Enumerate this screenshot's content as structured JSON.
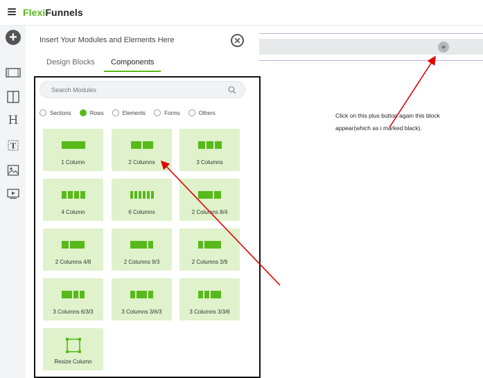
{
  "app": {
    "logo_part1": "Flexi",
    "logo_part2": "Funnels",
    "brand_color": "#58b91a"
  },
  "rail": {
    "icons": [
      "plus-icon",
      "section-icon",
      "columns-icon",
      "heading-icon",
      "text-icon",
      "image-icon",
      "video-icon"
    ]
  },
  "panel": {
    "title": "Insert Your Modules and Elements Here",
    "tabs": [
      {
        "label": "Design Blocks",
        "active": false
      },
      {
        "label": "Components",
        "active": true
      }
    ],
    "search_placeholder": "Search Modules",
    "filters": [
      {
        "label": "Sections",
        "checked": false
      },
      {
        "label": "Rows",
        "checked": true
      },
      {
        "label": "Elements",
        "checked": false
      },
      {
        "label": "Forms",
        "checked": false
      },
      {
        "label": "Others",
        "checked": false
      }
    ],
    "cards": [
      {
        "label": "1 Column"
      },
      {
        "label": "2 Columns"
      },
      {
        "label": "3 Columns"
      },
      {
        "label": "4 Column"
      },
      {
        "label": "6 Columns"
      },
      {
        "label": "2 Columns 8/4"
      },
      {
        "label": "2 Columns 4/8"
      },
      {
        "label": "2 Columns 9/3"
      },
      {
        "label": "2 Columns 3/9"
      },
      {
        "label": "3 Columns 6/3/3"
      },
      {
        "label": "3 Columns 3/6/3"
      },
      {
        "label": "3 Columns 3/3/6"
      },
      {
        "label": "Resize Column"
      }
    ]
  },
  "canvas": {
    "plus_symbol": "+",
    "note_line1": "Click on this plus button again this block",
    "note_line2": "appear(which as i marked black)."
  }
}
